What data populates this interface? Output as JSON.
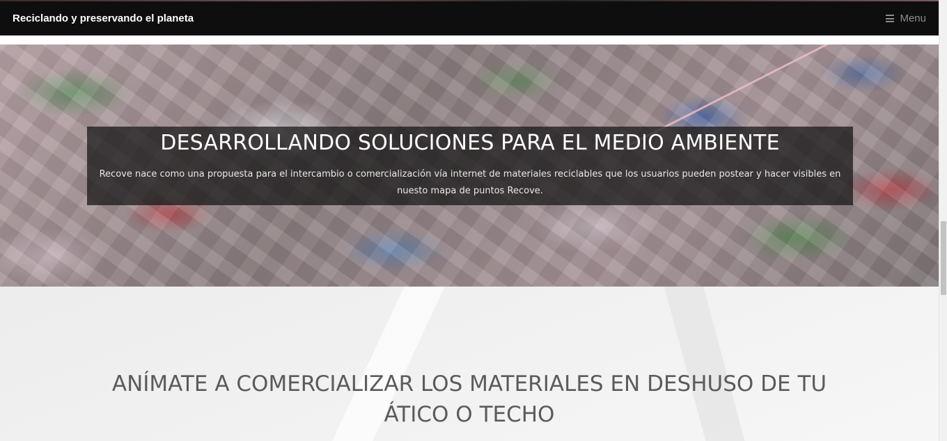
{
  "navbar": {
    "brand": "Reciclando y preservando el planeta",
    "menu_label": "Menu",
    "menu_icon": "hamburger-icon"
  },
  "hero": {
    "title": "DESARROLLANDO SOLUCIONES PARA EL MEDIO AMBIENTE",
    "text": "Recove nace como una propuesta para el intercambio o comercialización vía internet de materiales reciclables que los usuarios pueden postear y hacer visibles en nuesto mapa de puntos Recove."
  },
  "section": {
    "heading": "ANÍMATE A COMERCIALIZAR LOS MATERIALES EN DESHUSO DE TU ÁTICO O TECHO"
  },
  "colors": {
    "navbar_bg": "#0e0e0e",
    "caption_bg": "rgba(20,20,20,0.72)",
    "heading_text": "#5b5b5b"
  }
}
